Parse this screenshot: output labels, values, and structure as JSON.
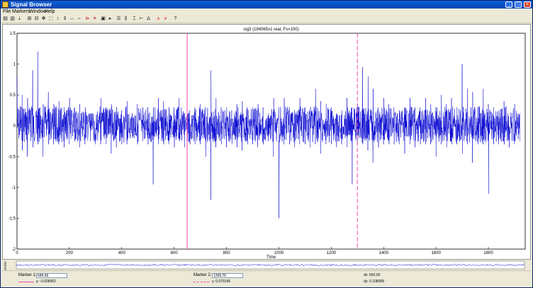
{
  "window": {
    "title": "Signal Browser",
    "controls": {
      "minimize": "_",
      "maximize": "□",
      "close": "×"
    }
  },
  "menu": [
    "File",
    "Markers",
    "Window",
    "Help"
  ],
  "toolbar": {
    "icons": [
      "print-icon",
      "print-preview-icon",
      "export-icon",
      "zoom-in-x-icon",
      "zoom-out-x-icon",
      "pan-icon",
      "zoom-box-icon",
      "zoom-y-icon",
      "zoom-in-y-icon",
      "zoom-out-y-icon",
      "fit-x-icon",
      "fit-y-icon",
      "marker-red-icon",
      "marker-list-icon",
      "marker-box-icon",
      "play-icon",
      "grid-h-icon",
      "grid-v-icon",
      "cursor-icon",
      "select-icon",
      "delta-icon",
      "red-cursor-icon",
      "red-cursor2-icon",
      "help-icon"
    ]
  },
  "plot": {
    "title": "sig3 (194065x1 real, Fs=100)",
    "xlabel": "Time"
  },
  "chart_data": {
    "type": "line",
    "title": "sig3 (194065x1 real, Fs=100)",
    "xlabel": "Time",
    "ylabel": "",
    "xlim": [
      0,
      1940.65
    ],
    "ylim": [
      -2,
      1.5
    ],
    "xticks": [
      0,
      200,
      400,
      600,
      800,
      1000,
      1200,
      1400,
      1600,
      1800
    ],
    "yticks": [
      -2,
      -1.5,
      -1,
      -0.5,
      0,
      0.5,
      1,
      1.5
    ],
    "ytick_labels": [
      "-2",
      "-1.5",
      "-1",
      "-0.5",
      "0",
      "0.5",
      "1",
      "1.5"
    ],
    "line_color": "#0000d0",
    "series": [
      {
        "sampled_points_x": [
          0,
          20,
          40,
          60,
          80,
          100,
          120,
          140,
          160,
          180,
          200,
          220,
          240,
          260,
          280,
          300,
          320,
          340,
          360,
          380,
          400,
          420,
          440,
          460,
          480,
          500,
          520,
          540,
          560,
          580,
          600,
          620,
          640,
          660,
          680,
          700,
          720,
          740,
          760,
          780,
          800,
          820,
          840,
          860,
          880,
          900,
          920,
          940,
          960,
          980,
          1000,
          1020,
          1040,
          1060,
          1080,
          1100,
          1120,
          1140,
          1160,
          1180,
          1200,
          1220,
          1240,
          1260,
          1280,
          1300,
          1320,
          1340,
          1360,
          1380,
          1400,
          1420,
          1440,
          1460,
          1480,
          1500,
          1520,
          1540,
          1560,
          1580,
          1600,
          1620,
          1640,
          1660,
          1680,
          1700,
          1720,
          1740,
          1760,
          1780,
          1800,
          1820,
          1840,
          1860,
          1880,
          1900,
          1920,
          1940
        ],
        "upper_envelope": [
          0.8,
          0.5,
          0.45,
          0.9,
          1.2,
          0.35,
          0.55,
          0.35,
          0.4,
          0.3,
          0.45,
          0.3,
          0.35,
          0.3,
          0.2,
          0.3,
          0.45,
          0.3,
          0.35,
          0.3,
          0.25,
          0.4,
          0.2,
          0.35,
          0.3,
          0.3,
          0.3,
          0.45,
          0.4,
          0.3,
          0.3,
          0.45,
          0.2,
          0.25,
          0.3,
          0.35,
          0.3,
          0.9,
          0.45,
          0.3,
          0.3,
          0.25,
          0.35,
          0.4,
          0.3,
          0.3,
          0.35,
          0.3,
          0.2,
          0.45,
          0.3,
          0.45,
          0.3,
          0.25,
          0.45,
          0.3,
          0.3,
          0.6,
          0.4,
          0.35,
          0.3,
          0.2,
          0.25,
          0.45,
          0.3,
          0.35,
          0.95,
          0.8,
          0.6,
          0.3,
          0.45,
          0.35,
          0.3,
          0.25,
          0.3,
          0.45,
          0.3,
          0.3,
          0.45,
          0.35,
          0.3,
          0.5,
          0.35,
          0.45,
          0.3,
          1.0,
          0.6,
          0.55,
          0.3,
          0.6,
          0.35,
          0.3,
          0.25,
          0.4,
          0.3,
          0.35,
          0.2
        ],
        "lower_envelope": [
          -0.4,
          -0.4,
          -0.5,
          -0.35,
          -0.3,
          -0.5,
          -0.3,
          -0.3,
          -0.3,
          -0.35,
          -0.3,
          -0.25,
          -0.35,
          -0.3,
          -0.25,
          -0.3,
          -0.3,
          -0.3,
          -0.45,
          -0.35,
          -0.3,
          -0.3,
          -0.2,
          -0.3,
          -0.25,
          -0.3,
          -0.95,
          -0.3,
          -0.3,
          -0.3,
          -0.35,
          -0.25,
          -0.35,
          -0.3,
          -0.3,
          -0.3,
          -0.5,
          -1.2,
          -0.35,
          -0.3,
          -0.35,
          -0.3,
          -0.35,
          -0.4,
          -0.3,
          -0.3,
          -0.35,
          -0.3,
          -0.25,
          -0.5,
          -1.5,
          -0.3,
          -0.3,
          -0.35,
          -0.3,
          -0.3,
          -0.35,
          -0.3,
          -0.45,
          -0.3,
          -0.3,
          -0.35,
          -0.3,
          -0.35,
          -0.95,
          -0.3,
          -0.3,
          -0.4,
          -0.6,
          -0.35,
          -0.3,
          -0.3,
          -0.3,
          -0.3,
          -0.45,
          -0.3,
          -0.35,
          -0.3,
          -0.3,
          -0.3,
          -0.5,
          -0.3,
          -0.35,
          -0.3,
          -0.3,
          -0.45,
          -0.3,
          -0.6,
          -0.3,
          -0.3,
          -1.1,
          -0.3,
          -0.3,
          -0.3,
          -0.35,
          -0.3,
          -0.25
        ]
      }
    ],
    "markers": [
      {
        "name": "Marker 1",
        "x": 649.66,
        "color": "#ff44aa",
        "style": "solid"
      },
      {
        "name": "Marker 2",
        "x": 1299.76,
        "color": "#ff44aa",
        "style": "dashed"
      }
    ]
  },
  "markers_panel": {
    "m1_label": "Marker 1:",
    "m1_value": "649.66",
    "m1_y": "y: -0.028952",
    "m2_label": "Marker 2:",
    "m2_value": "1299.76",
    "m2_y": "y: 0.079196",
    "dx": "dx: 650.00",
    "dy": "dy: 0.108068"
  },
  "overview": {
    "label": "Panner"
  }
}
